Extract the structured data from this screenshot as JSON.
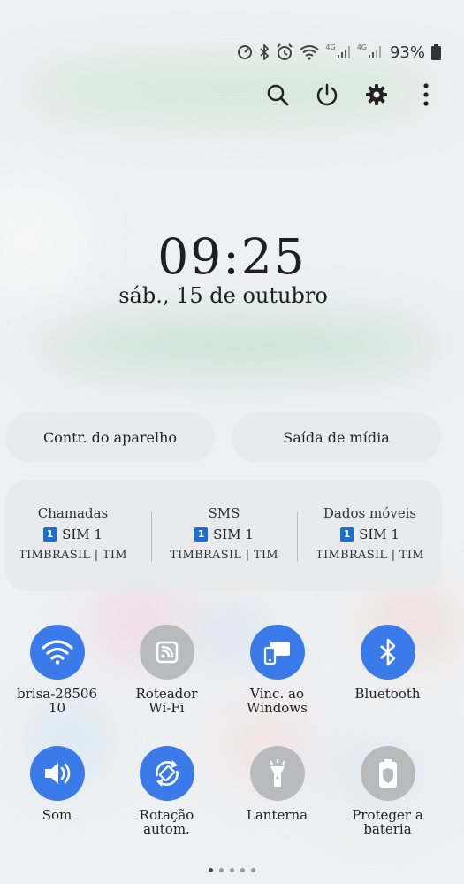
{
  "status_bar": {
    "battery_percent": "93%",
    "signal1_label": "4G",
    "signal2_label": "4G",
    "icons": [
      "speedometer-icon",
      "bluetooth-icon",
      "alarm-icon",
      "wifi-icon",
      "signal-icon",
      "signal-icon",
      "battery-icon"
    ]
  },
  "toolbar": {
    "icons": [
      "search-icon",
      "power-icon",
      "settings-icon",
      "more-icon"
    ]
  },
  "lock": {
    "time": "09:25",
    "date": "sáb., 15 de outubro"
  },
  "buttons": {
    "device_control": "Contr. do aparelho",
    "media_output": "Saída de mídia"
  },
  "sim": {
    "badge": "1",
    "columns": [
      {
        "title": "Chamadas",
        "sim": "SIM 1",
        "operator": "TIMBRASIL | TIM"
      },
      {
        "title": "SMS",
        "sim": "SIM 1",
        "operator": "TIMBRASIL | TIM"
      },
      {
        "title": "Dados móveis",
        "sim": "SIM 1",
        "operator": "TIMBRASIL | TIM"
      }
    ]
  },
  "tiles": [
    {
      "label": "brisa-28506\n10",
      "icon": "wifi-icon",
      "state": "on"
    },
    {
      "label": "Roteador\nWi-Fi",
      "icon": "hotspot-icon",
      "state": "off"
    },
    {
      "label": "Vinc. ao\nWindows",
      "icon": "link-to-windows-icon",
      "state": "on"
    },
    {
      "label": "Bluetooth",
      "icon": "bluetooth-icon",
      "state": "on"
    },
    {
      "label": "Som",
      "icon": "sound-icon",
      "state": "on"
    },
    {
      "label": "Rotação\nautom.",
      "icon": "auto-rotate-icon",
      "state": "on"
    },
    {
      "label": "Lanterna",
      "icon": "flashlight-icon",
      "state": "off"
    },
    {
      "label": "Proteger a\nbateria",
      "icon": "battery-protect-icon",
      "state": "off"
    }
  ],
  "page_indicator": {
    "pages": 5,
    "current": 1
  },
  "colors": {
    "accent": "#3b7be9",
    "tile_off": "#b9babc",
    "sim_badge": "#1c6fd0"
  }
}
